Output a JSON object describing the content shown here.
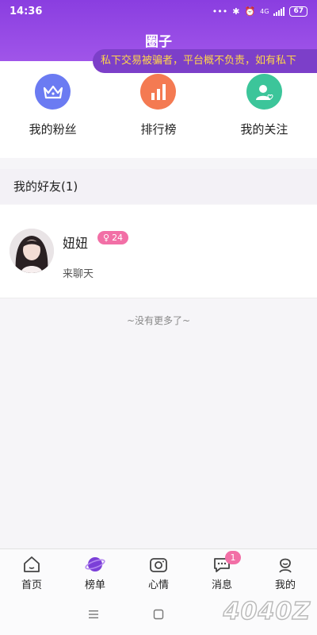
{
  "status": {
    "time": "14:36",
    "network": "4G",
    "battery": "67"
  },
  "header": {
    "title": "圈子"
  },
  "notice": {
    "text": "私下交易被骗者，平台概不负责，如有私下"
  },
  "quick_menu": [
    {
      "label": "我的粉丝",
      "icon": "crown-icon",
      "color": "#6b7bf2"
    },
    {
      "label": "排行榜",
      "icon": "bar-chart-icon",
      "color": "#f47a52"
    },
    {
      "label": "我的关注",
      "icon": "user-heart-icon",
      "color": "#3cc59a"
    }
  ],
  "friends_section": {
    "title": "我的好友(1)"
  },
  "friends": [
    {
      "name": "妞妞",
      "gender_symbol": "♀",
      "age": "24",
      "message": "来聊天"
    }
  ],
  "list_end": "~没有更多了~",
  "tabs": [
    {
      "label": "首页",
      "icon": "home-icon"
    },
    {
      "label": "榜单",
      "icon": "planet-icon"
    },
    {
      "label": "心情",
      "icon": "camera-icon"
    },
    {
      "label": "消息",
      "icon": "chat-icon",
      "badge": "1"
    },
    {
      "label": "我的",
      "icon": "profile-icon"
    }
  ],
  "watermark": "4040Z",
  "colors": {
    "header_gradient_top": "#8a3ee0",
    "badge_pink": "#f26fa6",
    "notice_text": "#ffd54a"
  }
}
